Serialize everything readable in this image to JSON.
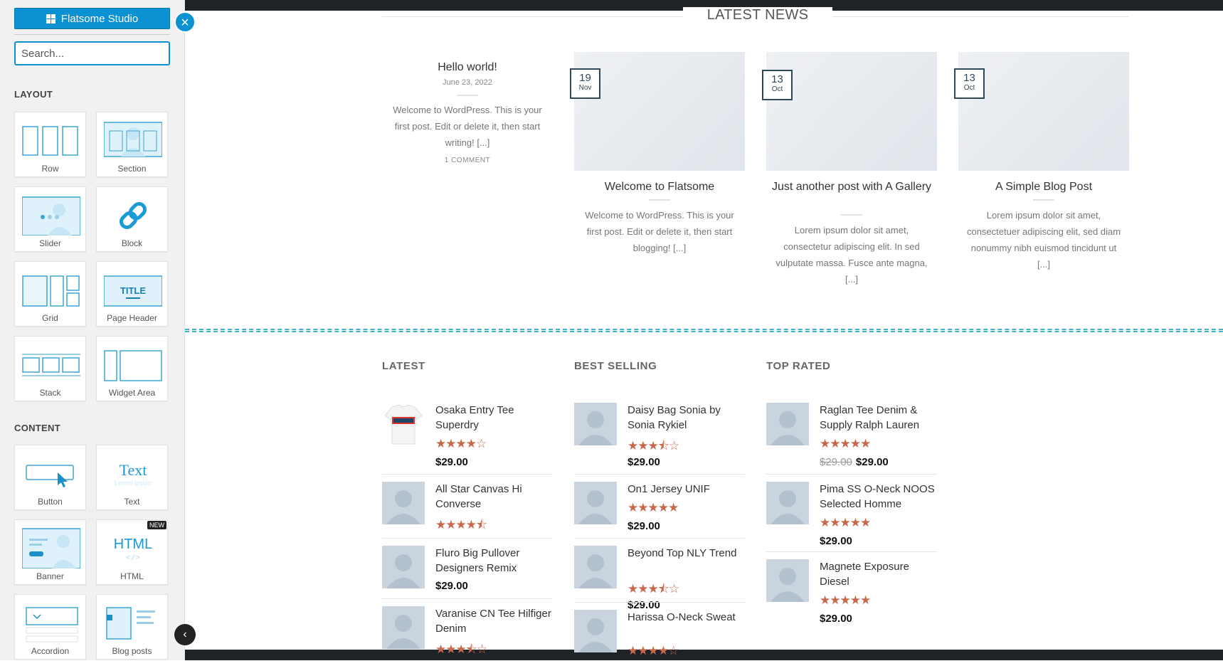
{
  "sidebar": {
    "studio_button": "Flatsome Studio",
    "search_placeholder": "Search...",
    "layout_title": "LAYOUT",
    "content_title": "CONTENT",
    "layout_items": [
      {
        "label": "Row",
        "icon": "row-icon"
      },
      {
        "label": "Section",
        "icon": "section-icon"
      },
      {
        "label": "Slider",
        "icon": "slider-icon"
      },
      {
        "label": "Block",
        "icon": "block-link-icon"
      },
      {
        "label": "Grid",
        "icon": "grid-icon"
      },
      {
        "label": "Page Header",
        "icon": "page-header-icon"
      },
      {
        "label": "Stack",
        "icon": "stack-icon"
      },
      {
        "label": "Widget Area",
        "icon": "widget-area-icon"
      }
    ],
    "content_items": [
      {
        "label": "Button",
        "icon": "button-icon"
      },
      {
        "label": "Text",
        "icon": "text-icon"
      },
      {
        "label": "Banner",
        "icon": "banner-icon"
      },
      {
        "label": "HTML",
        "icon": "html-icon",
        "badge": "NEW"
      },
      {
        "label": "Accordion",
        "icon": "accordion-icon"
      },
      {
        "label": "Blog posts",
        "icon": "blog-posts-icon"
      }
    ],
    "page_header_title": "TITLE",
    "text_tile_title": "Text",
    "text_tile_sub": "Lorem ipsum",
    "html_tile_title": "HTML",
    "html_tile_sub": "</>"
  },
  "news": {
    "title": "LATEST NEWS",
    "first_post": {
      "title": "Hello world!",
      "date": "June 23, 2022",
      "excerpt": "Welcome to WordPress. This is your first post. Edit or delete it, then start writing! [...]",
      "comments": "1 COMMENT"
    },
    "posts": [
      {
        "day": "19",
        "month": "Nov",
        "title": "Welcome to Flatsome",
        "excerpt": "Welcome to WordPress. This is your first post. Edit or delete it, then start blogging! [...]"
      },
      {
        "day": "13",
        "month": "Oct",
        "title": "Just another post with A Gallery",
        "excerpt": "Lorem ipsum dolor sit amet, consectetur adipiscing elit. In sed vulputate massa. Fusce ante magna, [...]"
      },
      {
        "day": "13",
        "month": "Oct",
        "title": "A Simple Blog Post",
        "excerpt": "Lorem ipsum dolor sit amet, consectetuer adipiscing elit, sed diam nonummy nibh euismod tincidunt ut [...]"
      }
    ]
  },
  "products": {
    "latest": {
      "title": "LATEST",
      "items": [
        {
          "name": "Osaka Entry Tee Superdry",
          "rating": 4,
          "price": "$29.00",
          "thumb": "tshirt"
        },
        {
          "name": "All Star Canvas Hi Converse",
          "rating": 4.5,
          "price": "",
          "thumb": "placeholder"
        },
        {
          "name": "Fluro Big Pullover Designers Remix",
          "rating": 0,
          "price": "$29.00",
          "thumb": "placeholder"
        },
        {
          "name": "Varanise CN Tee Hilfiger Denim",
          "rating": 3.5,
          "price": "",
          "thumb": "placeholder"
        }
      ]
    },
    "best_selling": {
      "title": "BEST SELLING",
      "items": [
        {
          "name": "Daisy Bag Sonia by Sonia Rykiel",
          "rating": 3.5,
          "price": "$29.00",
          "thumb": "placeholder"
        },
        {
          "name": "On1 Jersey UNIF",
          "rating": 5,
          "price": "$29.00",
          "thumb": "placeholder"
        },
        {
          "name": "Beyond Top NLY Trend",
          "rating": 3.5,
          "price": "$29.00",
          "thumb": "placeholder"
        },
        {
          "name": "Harissa O-Neck Sweat",
          "rating": 4,
          "price": "",
          "thumb": "placeholder"
        }
      ]
    },
    "top_rated": {
      "title": "TOP RATED",
      "items": [
        {
          "name": "Raglan Tee Denim & Supply Ralph Lauren",
          "rating": 5,
          "old_price": "$29.00",
          "price": "$29.00",
          "thumb": "placeholder"
        },
        {
          "name": "Pima SS O-Neck NOOS Selected Homme",
          "rating": 5,
          "price": "$29.00",
          "thumb": "placeholder"
        },
        {
          "name": "Magnete Exposure Diesel",
          "rating": 5,
          "price": "$29.00",
          "thumb": "placeholder"
        }
      ]
    }
  },
  "colors": {
    "accent": "#0c92d3",
    "star": "#c8684a",
    "dark_bar": "#1e2327",
    "date_badge": "#2f4858"
  }
}
